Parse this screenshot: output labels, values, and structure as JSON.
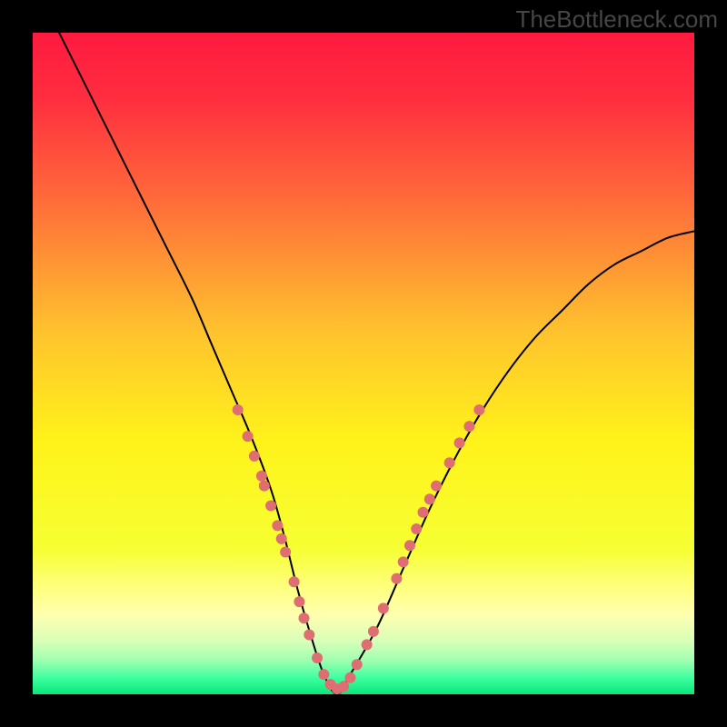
{
  "watermark": "TheBottleneck.com",
  "colors": {
    "frame": "#000000",
    "curve_stroke": "#000000",
    "beads_fill": "#de6e71",
    "gradient_stops": [
      {
        "offset": 0.0,
        "color": "#ff1a3f"
      },
      {
        "offset": 0.1,
        "color": "#ff2e3f"
      },
      {
        "offset": 0.25,
        "color": "#ff6a3a"
      },
      {
        "offset": 0.45,
        "color": "#ffc22e"
      },
      {
        "offset": 0.62,
        "color": "#fff31a"
      },
      {
        "offset": 0.78,
        "color": "#f6ff33"
      },
      {
        "offset": 0.84,
        "color": "#ffff80"
      },
      {
        "offset": 0.88,
        "color": "#ffffb0"
      },
      {
        "offset": 0.92,
        "color": "#d8ffb8"
      },
      {
        "offset": 0.95,
        "color": "#9cffb0"
      },
      {
        "offset": 0.975,
        "color": "#3fffa0"
      },
      {
        "offset": 1.0,
        "color": "#08e77b"
      }
    ]
  },
  "chart_data": {
    "type": "line",
    "title": "",
    "xlabel": "",
    "ylabel": "",
    "x_range": [
      0,
      100
    ],
    "y_range": [
      0,
      100
    ],
    "series": [
      {
        "name": "bottleneck-curve",
        "x": [
          0,
          4,
          8,
          12,
          16,
          20,
          24,
          27,
          30,
          33,
          36,
          38,
          40,
          42,
          44,
          46,
          48,
          52,
          56,
          60,
          64,
          68,
          72,
          76,
          80,
          84,
          88,
          92,
          96,
          100
        ],
        "y": [
          108,
          100,
          92,
          84,
          76,
          68,
          60,
          53,
          46,
          39,
          31,
          24,
          16,
          9,
          3,
          0,
          3,
          10,
          19,
          28,
          36,
          43,
          49,
          54,
          58,
          62,
          65,
          67,
          69,
          70
        ]
      }
    ],
    "markers": {
      "name": "beads",
      "approx_radius_px": 6,
      "points": [
        {
          "x": 31.0,
          "y": 43.0
        },
        {
          "x": 32.5,
          "y": 39.0
        },
        {
          "x": 33.5,
          "y": 36.0
        },
        {
          "x": 34.6,
          "y": 33.0
        },
        {
          "x": 35.0,
          "y": 31.5
        },
        {
          "x": 36.0,
          "y": 28.5
        },
        {
          "x": 37.0,
          "y": 25.5
        },
        {
          "x": 37.6,
          "y": 23.5
        },
        {
          "x": 38.2,
          "y": 21.5
        },
        {
          "x": 39.5,
          "y": 17.0
        },
        {
          "x": 40.3,
          "y": 14.0
        },
        {
          "x": 41.0,
          "y": 11.5
        },
        {
          "x": 41.8,
          "y": 9.0
        },
        {
          "x": 43.0,
          "y": 5.5
        },
        {
          "x": 44.0,
          "y": 3.0
        },
        {
          "x": 45.0,
          "y": 1.5
        },
        {
          "x": 46.0,
          "y": 0.8
        },
        {
          "x": 47.0,
          "y": 1.2
        },
        {
          "x": 48.0,
          "y": 2.5
        },
        {
          "x": 49.0,
          "y": 4.5
        },
        {
          "x": 50.5,
          "y": 7.5
        },
        {
          "x": 51.5,
          "y": 9.5
        },
        {
          "x": 53.0,
          "y": 13.0
        },
        {
          "x": 55.0,
          "y": 17.5
        },
        {
          "x": 56.0,
          "y": 20.0
        },
        {
          "x": 57.0,
          "y": 22.5
        },
        {
          "x": 58.0,
          "y": 25.0
        },
        {
          "x": 59.0,
          "y": 27.5
        },
        {
          "x": 60.0,
          "y": 29.5
        },
        {
          "x": 61.0,
          "y": 31.5
        },
        {
          "x": 63.0,
          "y": 35.0
        },
        {
          "x": 64.5,
          "y": 38.0
        },
        {
          "x": 66.0,
          "y": 40.5
        },
        {
          "x": 67.5,
          "y": 43.0
        }
      ]
    }
  }
}
